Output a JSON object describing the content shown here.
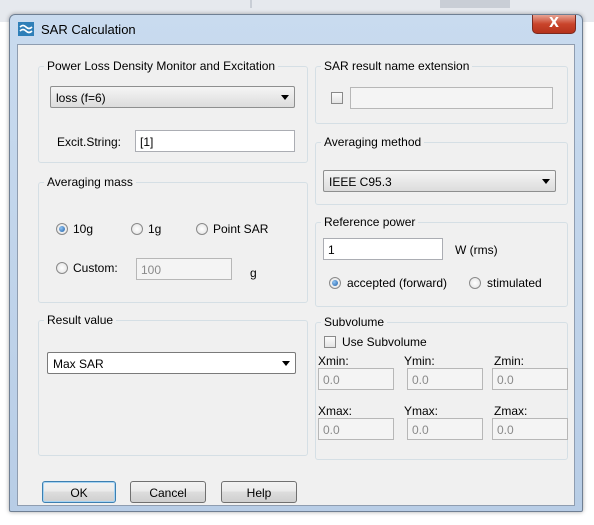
{
  "window": {
    "title": "SAR Calculation",
    "close_glyph": "X",
    "icon": "sar-app-icon"
  },
  "power_loss": {
    "legend": "Power Loss Density Monitor and Excitation",
    "monitor_value": "loss (f=6)",
    "excit_label": "Excit.String:",
    "excit_value": "[1]"
  },
  "averaging_mass": {
    "legend": "Averaging mass",
    "options": [
      "10g",
      "1g",
      "Point SAR"
    ],
    "selected": "10g",
    "custom_label": "Custom:",
    "custom_value": "100",
    "custom_unit": "g"
  },
  "result_value": {
    "legend": "Result value",
    "selected": "Max SAR"
  },
  "sar_extension": {
    "legend": "SAR result name extension",
    "checked": false,
    "value": ""
  },
  "averaging_method": {
    "legend": "Averaging method",
    "selected": "IEEE C95.3"
  },
  "reference_power": {
    "legend": "Reference power",
    "value": "1",
    "unit": "W (rms)",
    "options": [
      "accepted (forward)",
      "stimulated"
    ],
    "selected": "accepted (forward)"
  },
  "subvolume": {
    "legend": "Subvolume",
    "use_label": "Use Subvolume",
    "use_checked": false,
    "labels": {
      "xmin": "Xmin:",
      "ymin": "Ymin:",
      "zmin": "Zmin:",
      "xmax": "Xmax:",
      "ymax": "Ymax:",
      "zmax": "Zmax:"
    },
    "values": {
      "xmin": "0.0",
      "ymin": "0.0",
      "zmin": "0.0",
      "xmax": "0.0",
      "ymax": "0.0",
      "zmax": "0.0"
    }
  },
  "buttons": {
    "ok": "OK",
    "cancel": "Cancel",
    "help": "Help"
  },
  "colors": {
    "accent": "#1f5fa8",
    "close_button": "#c9442b"
  }
}
